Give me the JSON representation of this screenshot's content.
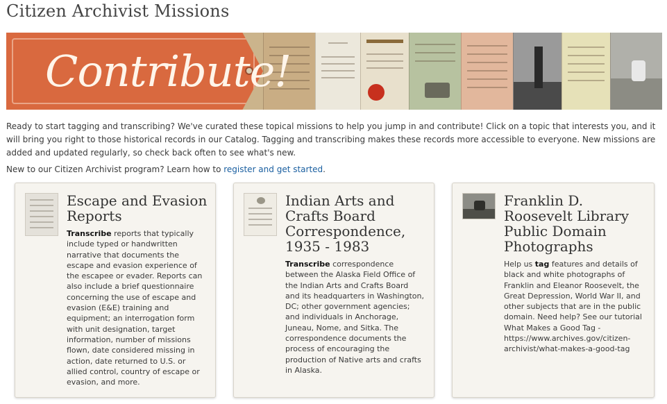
{
  "page": {
    "title": "Citizen Archivist Missions"
  },
  "banner": {
    "tag_text": "Contribute!"
  },
  "intro": {
    "paragraph": "Ready to start tagging and transcribing? We've curated these topical missions to help you jump in and contribute! Click on a topic that interests you, and it will bring you right to those historical records in our Catalog. Tagging and transcribing makes these records more accessible to everyone. New missions are added and updated regularly, so check back often to see what's new.",
    "new_prefix": "New to our Citizen Archivist program? Learn how to ",
    "new_link": "register and get started",
    "new_suffix": "."
  },
  "cards": [
    {
      "title_lines": [
        "Escape and Evasion",
        "Reports"
      ],
      "action": "Transcribe",
      "body": " reports that typically include typed or handwritten narrative that documents the escape and evasion experience of the escapee or evader. Reports can also include a brief questionnaire concerning the use of escape and evasion (E&E) training and equipment; an interrogation form with unit designation, target information, number of missions flown, date considered missing in action, date returned to U.S. or allied control, country of escape or evasion, and more."
    },
    {
      "title_lines": [
        "Indian Arts and",
        "Crafts Board",
        "Correspondence,",
        "1935 - 1983"
      ],
      "action": "Transcribe",
      "body": " correspondence between the Alaska Field Office of the Indian Arts and Crafts Board and its headquarters in Washington, DC; other government agencies; and individuals in Anchorage, Juneau, Nome, and Sitka. The correspondence documents the process of encouraging the production of Native arts and crafts in Alaska."
    },
    {
      "title_lines": [
        "Franklin D.",
        "Roosevelt Library",
        "Public Domain",
        "Photographs"
      ],
      "prefix": "Help us ",
      "action": "tag",
      "body": " features and details of black and white photographs of Franklin and Eleanor Roosevelt, the Great Depression, World War II, and other subjects that are in the public domain. Need help? See our tutorial What Makes a Good Tag - https://www.archives.gov/citizen-archivist/what-makes-a-good-tag"
    }
  ],
  "colors": {
    "banner_orange": "#d9693f",
    "link_blue": "#1a5fa0",
    "card_bg": "#f6f4ef"
  }
}
